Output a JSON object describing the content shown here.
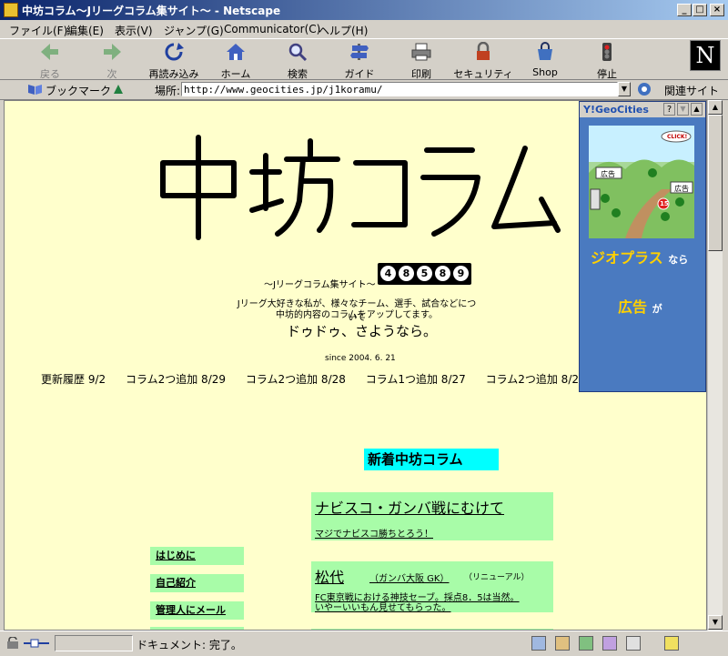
{
  "window": {
    "title": "中坊コラム〜Jリーグコラム集サイト〜 - Netscape",
    "minimize": "_",
    "maximize": "□",
    "close": "×"
  },
  "menu": [
    "ファイル(F)",
    "編集(E)",
    "表示(V)",
    "ジャンプ(G)",
    "Communicator(C)",
    "ヘルプ(H)"
  ],
  "toolbar": [
    {
      "label": "戻る",
      "icon": "back-arrow-icon",
      "enabled": false
    },
    {
      "label": "次",
      "icon": "forward-arrow-icon",
      "enabled": false
    },
    {
      "label": "再読み込み",
      "icon": "reload-icon",
      "enabled": true
    },
    {
      "label": "ホーム",
      "icon": "home-icon",
      "enabled": true
    },
    {
      "label": "検索",
      "icon": "search-icon",
      "enabled": true
    },
    {
      "label": "ガイド",
      "icon": "guide-icon",
      "enabled": true
    },
    {
      "label": "印刷",
      "icon": "print-icon",
      "enabled": true
    },
    {
      "label": "セキュリティ",
      "icon": "lock-icon",
      "enabled": true
    },
    {
      "label": "Shop",
      "icon": "shop-icon",
      "enabled": true
    },
    {
      "label": "停止",
      "icon": "stop-icon",
      "enabled": true
    }
  ],
  "brand_logo": "N",
  "location": {
    "bookmarks_label": "ブックマーク",
    "location_label": "場所:",
    "url": "http://www.geocities.jp/j1koramu/",
    "related_label": "関連サイト"
  },
  "page": {
    "logo_text": "中坊コラム",
    "tagline": "〜Jリーグコラム集サイト〜",
    "counter": [
      "4",
      "8",
      "5",
      "8",
      "9"
    ],
    "desc_line1": "Jリーグ大好きな私が、様々なチーム、選手、試合などについて",
    "desc_line2": "中坊的内容のコラムをアップしてます。",
    "farewell": "ドゥドゥ、さようなら。",
    "since": "since 2004. 6. 21",
    "updates": [
      "更新履歴 9/2",
      "コラム2つ追加 8/29",
      "コラム2つ追加 8/28",
      "コラム1つ追加 8/27",
      "コラム2つ追加 8/2"
    ],
    "new_columns_title": "新着中坊コラム",
    "columns": [
      {
        "title": "ナビスコ・ガンバ戦にむけて",
        "subtitle": "",
        "note": "",
        "desc": "マジでナビスコ勝ちとろう！"
      },
      {
        "title": "松代",
        "subtitle": "（ガンバ大阪 GK）",
        "note": "（リニューアル）",
        "desc": "FC東京戦における神技セーブ。採点8．5は当然。",
        "desc2": "いやーいいもん見せてもらった。"
      }
    ],
    "nav": [
      "はじめに",
      "自己紹介",
      "管理人にメール",
      ""
    ]
  },
  "ad": {
    "brand": "Y!GeoCities",
    "help": "?",
    "click_label": "CLICK!",
    "sign1": "広告",
    "sign2": "広告",
    "route": "15",
    "line1_main": "ジオプラス",
    "line1_suffix": "なら",
    "line2_main": "広告",
    "line2_suffix": "が"
  },
  "status": {
    "text": "ドキュメント: 完了。"
  }
}
